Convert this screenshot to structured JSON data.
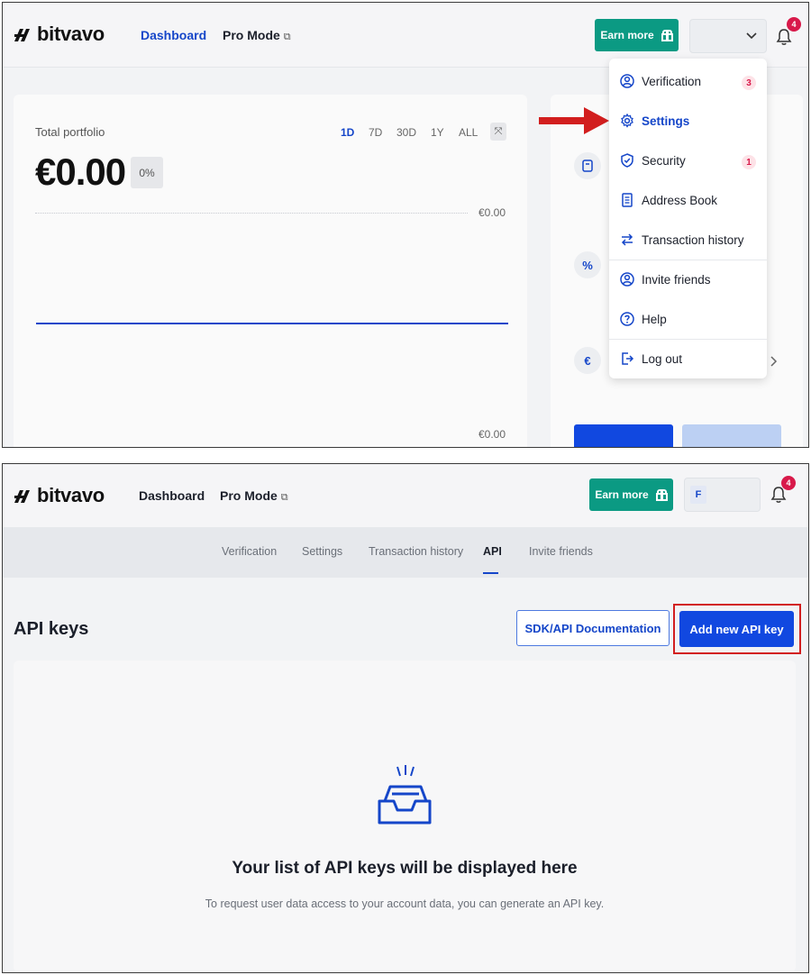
{
  "brand": {
    "name": "bitvavo"
  },
  "colors": {
    "accent": "#1546c9",
    "earn": "#0b9a83",
    "badge": "#d8194a",
    "annotation": "#d21e1e"
  },
  "top": {
    "nav": {
      "dashboard": "Dashboard",
      "pro_mode": "Pro Mode",
      "pro_mode_icon": "external-link-icon"
    },
    "earn_label": "Earn more",
    "notifications": "4",
    "portfolio": {
      "title": "Total portfolio",
      "amount": "€0.00",
      "change": "0%",
      "ranges": [
        "1D",
        "7D",
        "30D",
        "1Y",
        "ALL"
      ],
      "selected_range": "1D",
      "axis_top": "€0.00",
      "axis_bottom": "€0.00"
    },
    "menu": [
      {
        "label": "Verification",
        "icon": "user-circle-icon",
        "badge": "3"
      },
      {
        "label": "Settings",
        "icon": "gear-icon",
        "active": true
      },
      {
        "label": "Security",
        "icon": "shield-icon",
        "badge": "1"
      },
      {
        "label": "Address Book",
        "icon": "book-icon"
      },
      {
        "label": "Transaction history",
        "icon": "arrows-icon"
      },
      {
        "label": "Invite friends",
        "icon": "user-plus-icon"
      },
      {
        "label": "Help",
        "icon": "help-icon"
      },
      {
        "label": "Log out",
        "icon": "logout-icon"
      }
    ],
    "side_icons": [
      "wallet-icon",
      "percent-icon",
      "euro-icon"
    ],
    "side_glyphs": {
      "percent": "%",
      "euro": "€"
    }
  },
  "bottom": {
    "nav": {
      "dashboard": "Dashboard",
      "pro_mode": "Pro Mode"
    },
    "earn_label": "Earn more",
    "user_initial": "F",
    "notifications": "4",
    "tabs": [
      "Verification",
      "Settings",
      "Transaction history",
      "API",
      "Invite friends"
    ],
    "active_tab": "API",
    "page_title": "API keys",
    "doc_button": "SDK/API Documentation",
    "add_button": "Add new API key",
    "empty_title": "Your list of API keys will be displayed here",
    "empty_subtitle": "To request user data access to your account data, you can generate an API key."
  }
}
